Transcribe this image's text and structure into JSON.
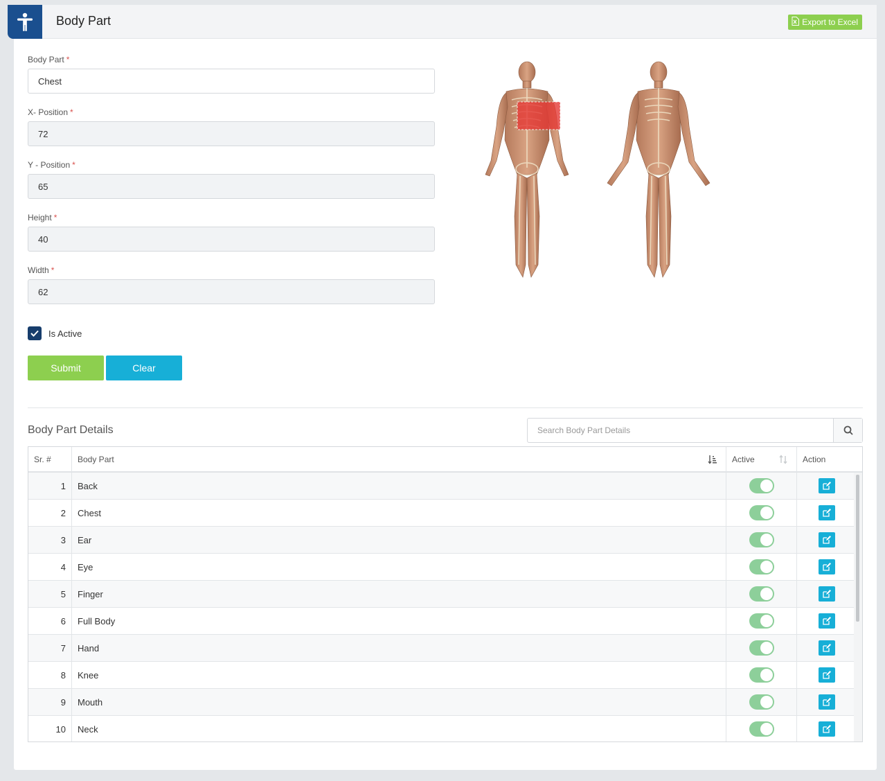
{
  "header": {
    "title": "Body Part",
    "export_label": "Export to Excel"
  },
  "form": {
    "body_part": {
      "label": "Body Part",
      "required": "*",
      "value": "Chest"
    },
    "x_position": {
      "label": "X- Position",
      "required": "*",
      "value": "72"
    },
    "y_position": {
      "label": "Y - Position",
      "required": "*",
      "value": "65"
    },
    "height": {
      "label": "Height",
      "required": "*",
      "value": "40"
    },
    "width": {
      "label": "Width",
      "required": "*",
      "value": "62"
    },
    "is_active_label": "Is Active",
    "submit_label": "Submit",
    "clear_label": "Clear"
  },
  "details": {
    "title": "Body Part Details",
    "search_placeholder": "Search Body Part Details",
    "columns": {
      "sr": "Sr. #",
      "body_part": "Body Part",
      "active": "Active",
      "action": "Action"
    },
    "rows": [
      {
        "sr": "1",
        "body_part": "Back"
      },
      {
        "sr": "2",
        "body_part": "Chest"
      },
      {
        "sr": "3",
        "body_part": "Ear"
      },
      {
        "sr": "4",
        "body_part": "Eye"
      },
      {
        "sr": "5",
        "body_part": "Finger"
      },
      {
        "sr": "6",
        "body_part": "Full Body"
      },
      {
        "sr": "7",
        "body_part": "Hand"
      },
      {
        "sr": "8",
        "body_part": "Knee"
      },
      {
        "sr": "9",
        "body_part": "Mouth"
      },
      {
        "sr": "10",
        "body_part": "Neck"
      }
    ]
  },
  "colors": {
    "primary": "#1a4f8f",
    "success": "#8dcf4f",
    "info": "#17afd7",
    "toggle_on": "#8dcf9a",
    "highlight": "#e53935"
  },
  "icons": {
    "header": "accessibility-icon",
    "export": "excel-file-icon",
    "search": "search-icon",
    "edit": "edit-icon",
    "check": "check-icon"
  }
}
